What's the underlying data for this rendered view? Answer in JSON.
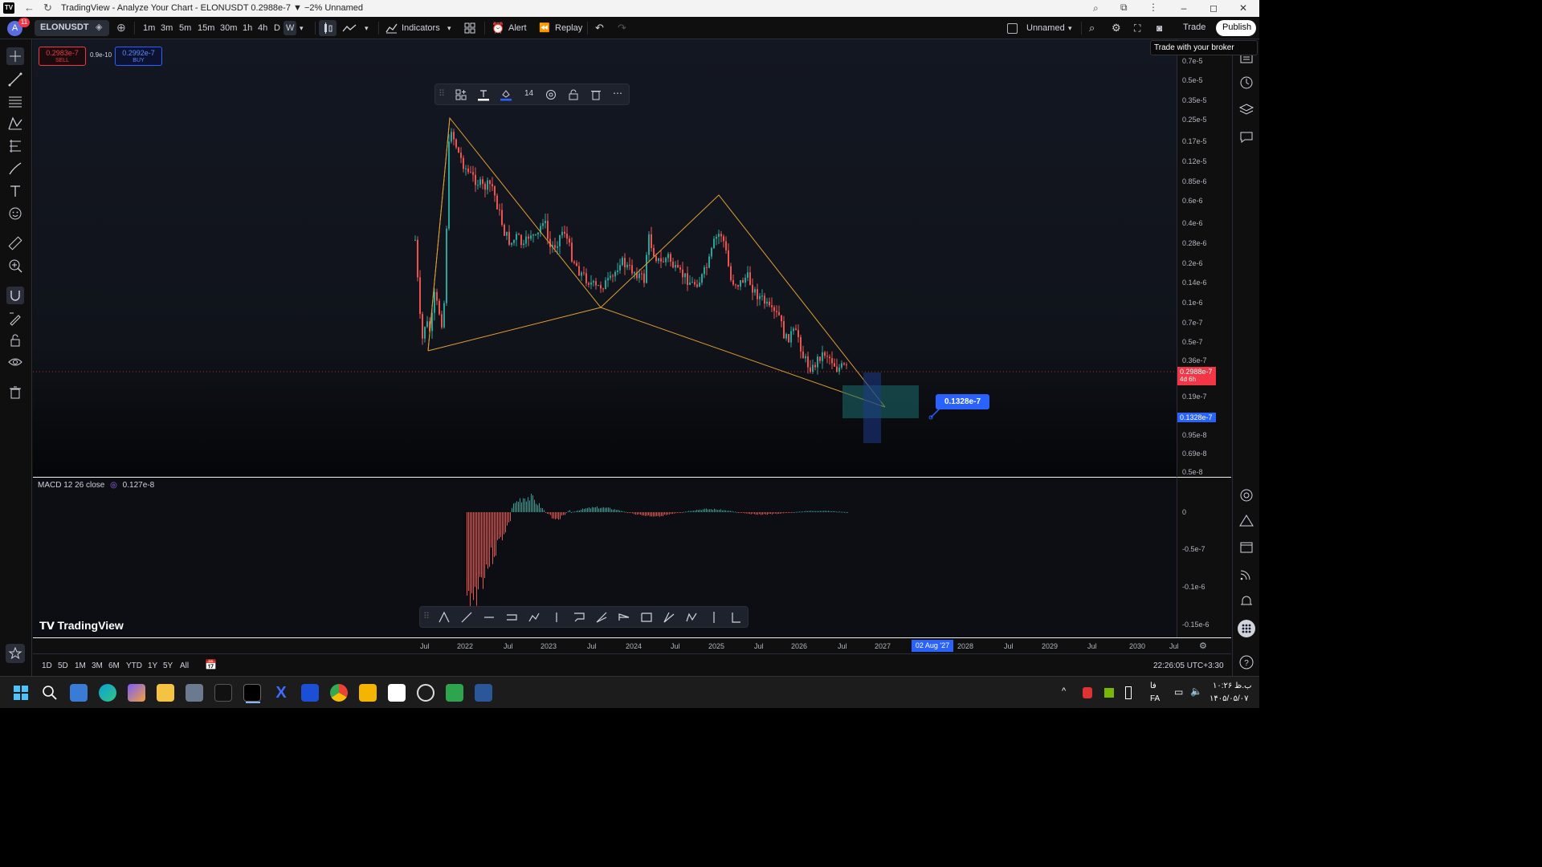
{
  "window": {
    "title": "TradingView - Analyze Your Chart - ELONUSDT 0.2988e-7 ▼ −2% Unnamed",
    "controls": [
      "–",
      "◻",
      "✕"
    ]
  },
  "toolbar": {
    "avatar_letter": "A",
    "notif_count": "11",
    "symbol": "ELONUSDT",
    "timeframes": [
      "1m",
      "3m",
      "5m",
      "15m",
      "30m",
      "1h",
      "4h",
      "D",
      "W"
    ],
    "active_timeframe": "W",
    "indicators_label": "Indicators",
    "alert_label": "Alert",
    "replay_label": "Replay",
    "layout_name": "Unnamed",
    "trade_label": "Trade",
    "publish_label": "Publish",
    "tooltip": "Trade with your broker"
  },
  "order": {
    "sell_price": "0.2983e-7",
    "sell_label": "SELL",
    "spread": "0.9e-10",
    "buy_price": "0.2992e-7",
    "buy_label": "BUY"
  },
  "drawing_toolbar": {
    "font_size": "14"
  },
  "price_scale": {
    "labels": [
      "0.7e-5",
      "0.5e-5",
      "0.35e-5",
      "0.25e-5",
      "0.17e-5",
      "0.12e-5",
      "0.85e-6",
      "0.6e-6",
      "0.4e-6",
      "0.28e-6",
      "0.2e-6",
      "0.14e-6",
      "0.1e-6",
      "0.7e-7",
      "0.5e-7",
      "0.36e-7",
      "0.19e-7",
      "0.95e-8",
      "0.69e-8",
      "0.5e-8"
    ],
    "current_price": "0.2988e-7",
    "countdown": "4d 6h",
    "target_price": "0.1328e-7",
    "target_callout": "0.1328e-7"
  },
  "macd": {
    "label": "MACD 12 26 close",
    "value": "0.127e-8",
    "scale_labels": [
      "0",
      "-0.5e-7",
      "-0.1e-6",
      "-0.15e-6"
    ]
  },
  "brand": "TradingView",
  "time_axis": {
    "labels": [
      "Jul",
      "2022",
      "Jul",
      "2023",
      "Jul",
      "2024",
      "Jul",
      "2025",
      "Jul",
      "2026",
      "Jul",
      "2027",
      "2028",
      "Jul",
      "2029",
      "Jul",
      "2030",
      "Jul"
    ],
    "highlight": "02 Aug '27"
  },
  "ranges": [
    "1D",
    "5D",
    "1M",
    "3M",
    "6M",
    "YTD",
    "1Y",
    "5Y",
    "All"
  ],
  "clock": "22:26:05 UTC+3:30",
  "taskbar": {
    "lang": "FA",
    "lang_top": "فا",
    "time": "۱۰:۲۶ ب.ظ",
    "date": "۱۴۰۵/۰۵/۰۷"
  },
  "colors": {
    "bg": "#131722",
    "up": "#26a69a",
    "down": "#ef5350",
    "pattern": "#e0a030",
    "accent": "#2962ff"
  }
}
